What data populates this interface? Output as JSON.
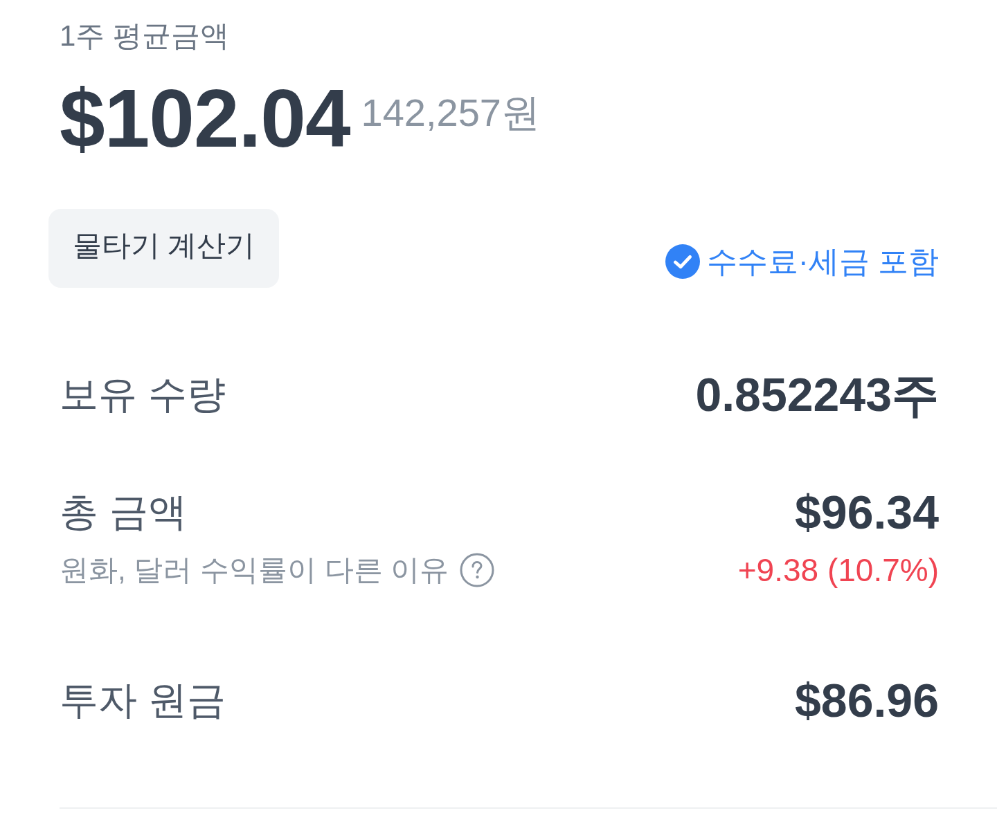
{
  "average_price": {
    "label": "1주 평균금액",
    "usd": "$102.04",
    "krw": "142,257원"
  },
  "calculator_button": {
    "label": "물타기 계산기"
  },
  "fee_badge": {
    "checked": true,
    "label": "수수료·세금 포함"
  },
  "rows": [
    {
      "label": "보유 수량",
      "value": "0.852243주"
    },
    {
      "label": "총 금액",
      "value": "$96.34",
      "note": "원화, 달러 수익률이 다른 이유",
      "change": "+9.38 (10.7%)",
      "positive": true
    },
    {
      "label": "투자 원금",
      "value": "$86.96"
    }
  ]
}
